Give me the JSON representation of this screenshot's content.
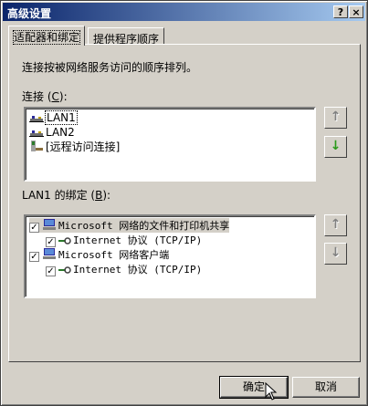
{
  "window": {
    "title": "高级设置",
    "help_btn": "?",
    "close_btn": "×"
  },
  "tabs": [
    {
      "label": "适配器和绑定"
    },
    {
      "label": "提供程序顺序"
    }
  ],
  "description": "连接按被网络服务访问的顺序排列。",
  "connections": {
    "label_pre": "连接 (",
    "label_key": "C",
    "label_post": "):",
    "items": [
      {
        "label": "LAN1",
        "icon": "network-adapter-icon",
        "selected": true
      },
      {
        "label": "LAN2",
        "icon": "network-adapter-icon",
        "selected": false
      },
      {
        "label": "[远程访问连接]",
        "icon": "remote-access-icon",
        "selected": false
      }
    ]
  },
  "bindings": {
    "label_pre": "LAN1 的绑定 (",
    "label_key": "B",
    "label_post": "):",
    "items": [
      {
        "label": "Microsoft 网络的文件和打印机共享",
        "checked": true,
        "level": 0
      },
      {
        "label": "Internet 协议 (TCP/IP)",
        "checked": true,
        "level": 1
      },
      {
        "label": "Microsoft 网络客户端",
        "checked": true,
        "level": 0
      },
      {
        "label": "Internet 协议 (TCP/IP)",
        "checked": true,
        "level": 1
      }
    ]
  },
  "arrows": {
    "up": "↑",
    "down": "↓"
  },
  "buttons": {
    "ok": "确定",
    "cancel": "取消"
  },
  "colors": {
    "title_start": "#0a246a",
    "title_end": "#a6caf0",
    "face": "#d4d0c8",
    "green_arrow": "#2a9a1a"
  }
}
